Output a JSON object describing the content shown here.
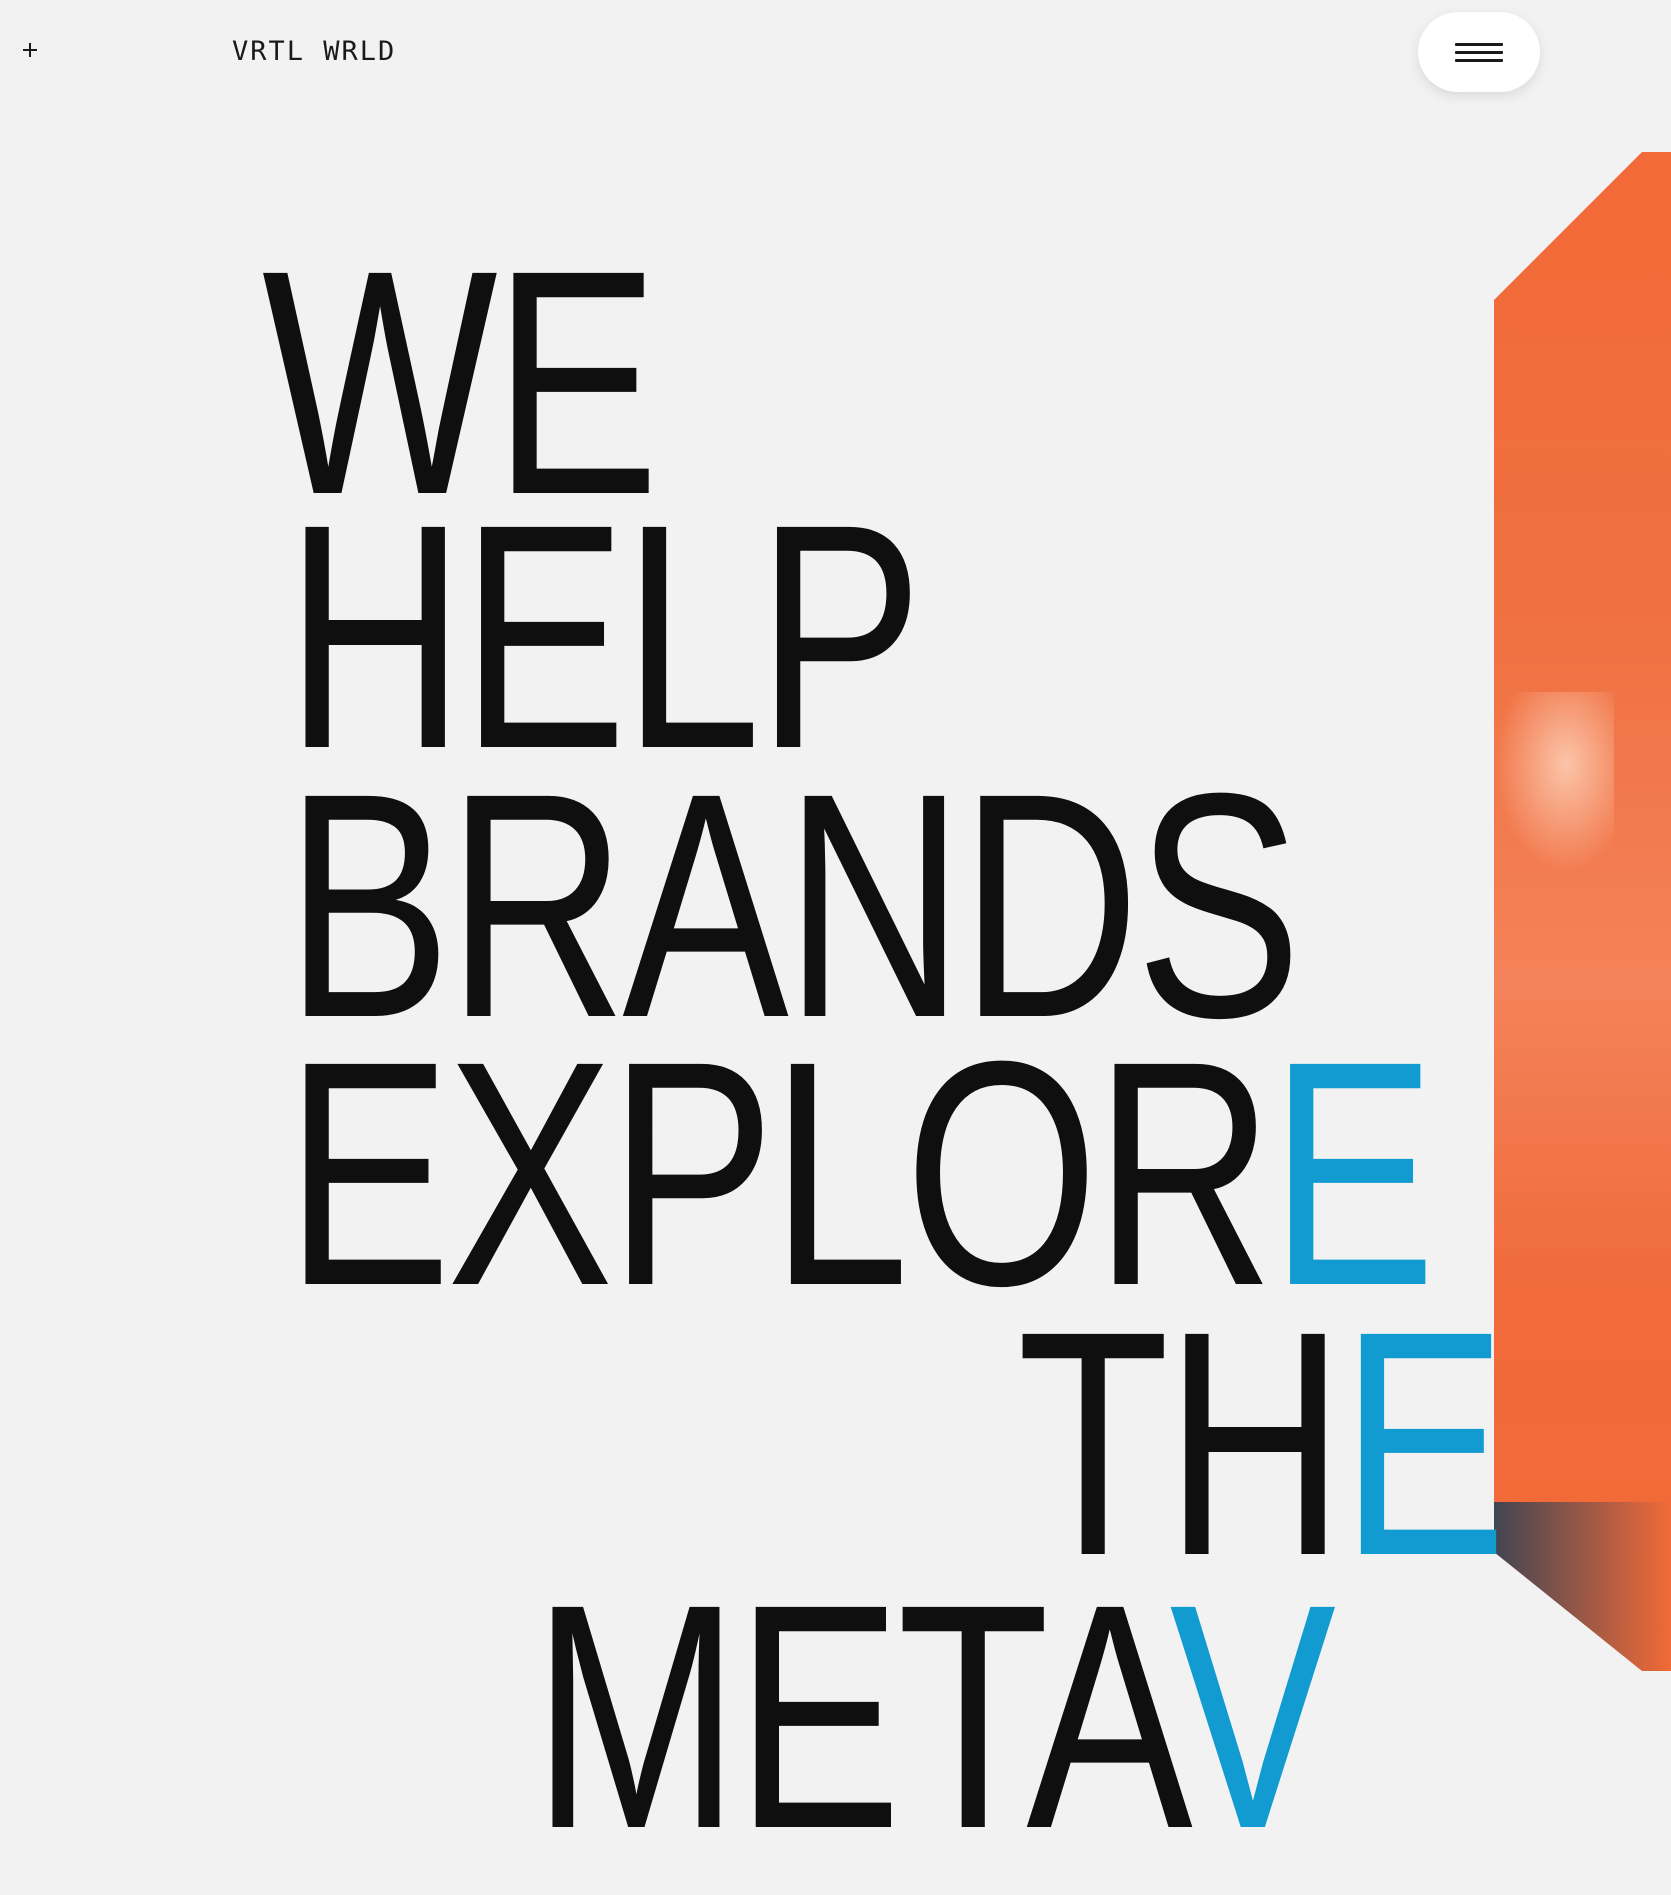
{
  "header": {
    "plus_icon": "plus-icon",
    "logo": "VRTL WRLD",
    "menu_icon": "hamburger-icon"
  },
  "hero": {
    "line1": "WE",
    "line2": "HELP",
    "line3": "BRANDS",
    "line4_main": "EXPLOR",
    "line4_end": "E",
    "line5_main": "TH",
    "line5_end": "E",
    "line6_main": "META",
    "line6_end": "V"
  },
  "colors": {
    "background": "#f2f2f2",
    "text": "#0f0f0f",
    "accent_orange": "#f26a37",
    "accent_blue": "#129bd1"
  }
}
